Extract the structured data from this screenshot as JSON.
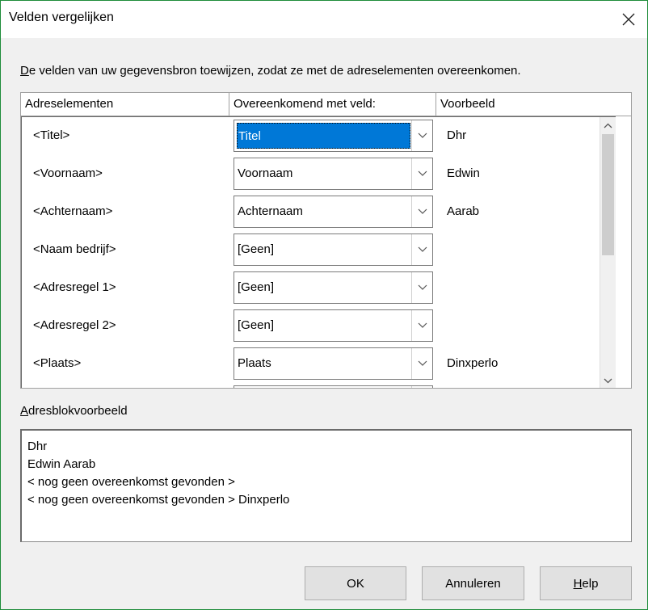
{
  "window": {
    "title": "Velden vergelijken"
  },
  "instruction": {
    "first_letter": "D",
    "rest": "e velden van uw gegevensbron toewijzen, zodat ze met de adreselementen overeenkomen."
  },
  "table": {
    "headers": [
      "Adreselementen",
      "Overeenkomend met veld:",
      "Voorbeeld"
    ],
    "rows": [
      {
        "element": "<Titel>",
        "field": "Titel",
        "example": "Dhr"
      },
      {
        "element": "<Voornaam>",
        "field": "Voornaam",
        "example": "Edwin"
      },
      {
        "element": "<Achternaam>",
        "field": "Achternaam",
        "example": "Aarab"
      },
      {
        "element": "<Naam bedrijf>",
        "field": "[Geen]",
        "example": ""
      },
      {
        "element": "<Adresregel 1>",
        "field": "[Geen]",
        "example": ""
      },
      {
        "element": "<Adresregel 2>",
        "field": "[Geen]",
        "example": ""
      },
      {
        "element": "<Plaats>",
        "field": "Plaats",
        "example": "Dinxperlo"
      },
      {
        "element": "",
        "field": "",
        "example": ""
      }
    ]
  },
  "preview": {
    "label_first_letter": "A",
    "label_rest": "dresblokvoorbeeld",
    "lines": [
      "Dhr",
      "Edwin Aarab",
      "< nog geen overeenkomst gevonden >",
      "< nog geen overeenkomst gevonden > Dinxperlo"
    ]
  },
  "buttons": {
    "ok": "OK",
    "cancel": "Annuleren",
    "help_first_letter": "H",
    "help_rest": "elp"
  },
  "icons": {
    "close": "close-icon",
    "combo_arrow": "chevron-down-icon",
    "scroll_up": "chevron-up-icon",
    "scroll_down": "chevron-down-icon"
  },
  "colors": {
    "selection": "#0078d7",
    "window_border": "#1e8c3a"
  }
}
